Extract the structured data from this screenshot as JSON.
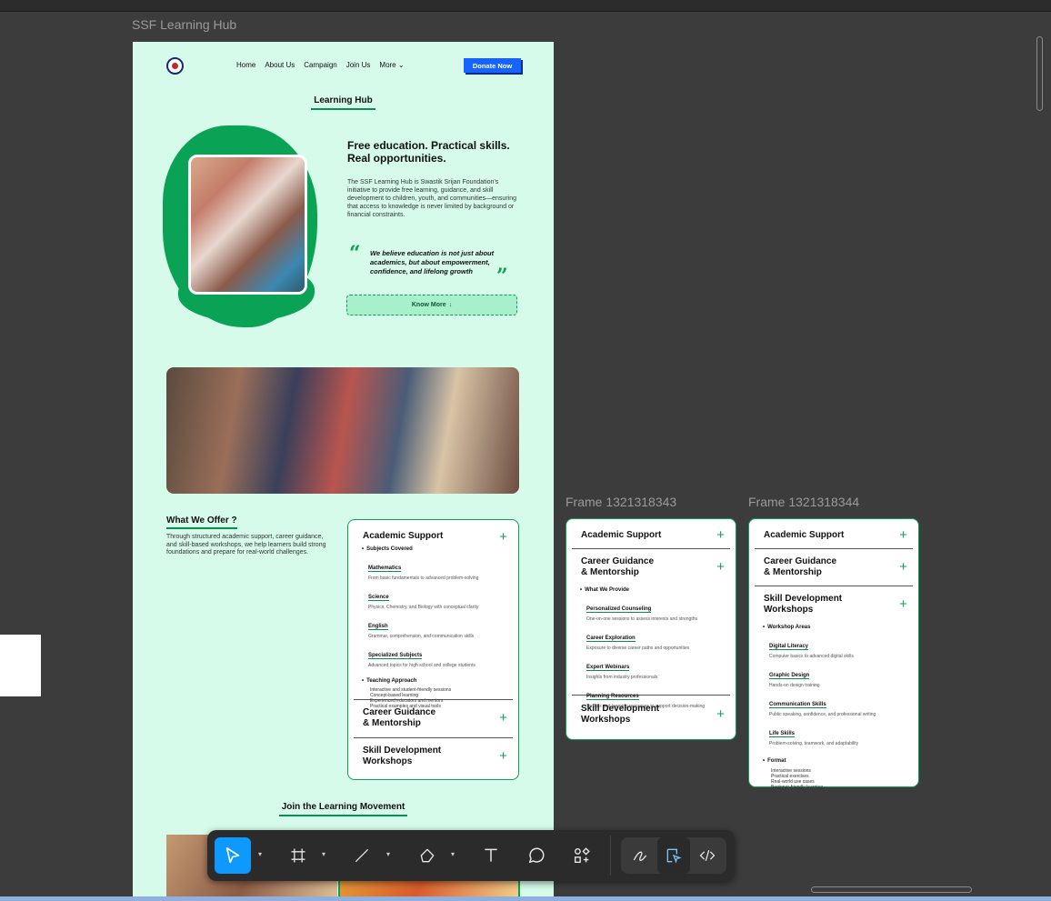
{
  "canvas": {
    "main_frame_title": "SSF Learning Hub",
    "frame_a_title": "Frame 1321318343",
    "frame_b_title": "Frame 1321318344"
  },
  "nav": {
    "links": [
      "Home",
      "About Us",
      "Campaign",
      "Join Us",
      "More"
    ],
    "donate_label": "Donate Now"
  },
  "hero": {
    "section_title": "Learning Hub",
    "heading": "Free education. Practical skills. Real opportunities.",
    "body": "The SSF Learning Hub is Swastik Srijan Foundation's initiative to provide free learning, guidance, and skill development to children, youth, and communities—ensuring that access to knowledge is never limited by background or financial constraints.",
    "quote": "We believe education is not just about academics, but about empowerment, confidence, and lifelong growth",
    "know_more_label": "Know More",
    "quote_open_mark": "“",
    "quote_close_mark": "”"
  },
  "offer": {
    "title": "What We Offer ?",
    "body": "Through structured academic support, career guidance, and skill-based workshops, we help learners build strong foundations and prepare for real-world challenges."
  },
  "accordion": {
    "academic": {
      "title": "Academic Support",
      "subjects_label": "Subjects Covered",
      "subjects": [
        {
          "name": "Mathematics",
          "desc": "From basic fundamentals to advanced problem-solving"
        },
        {
          "name": "Science",
          "desc": "Physics, Chemistry, and Biology with conceptual clarity"
        },
        {
          "name": "English",
          "desc": "Grammar, comprehension, and communication skills"
        },
        {
          "name": "Specialized Subjects",
          "desc": "Advanced topics for high school and college students"
        }
      ],
      "approach_label": "Teaching Approach",
      "approach": [
        "Interactive and student-friendly sessions",
        "Concept-based learning",
        "Experienced educators and mentors",
        "Practical examples and visual tools"
      ]
    },
    "career": {
      "title": "Career Guidance & Mentorship",
      "provide_label": "What We Provide",
      "items": [
        {
          "name": "Personalized Counseling",
          "desc": "One-on-one sessions to assess interests and strengths"
        },
        {
          "name": "Career Exploration",
          "desc": "Exposure to diverse career paths and opportunities"
        },
        {
          "name": "Expert Webinars",
          "desc": "Insights from industry professionals"
        },
        {
          "name": "Planning Resources",
          "desc": "Toolkits and learning resources to support decision-making"
        }
      ]
    },
    "skill": {
      "title": "Skill Development Workshops",
      "areas_label": "Workshop Areas",
      "items": [
        {
          "name": "Digital Literacy",
          "desc": "Computer basics to advanced digital skills"
        },
        {
          "name": "Graphic Design",
          "desc": "Hands-on design training"
        },
        {
          "name": "Communication Skills",
          "desc": "Public speaking, confidence, and professional writing"
        },
        {
          "name": "Life Skills",
          "desc": "Problem-solving, teamwork, and adaptability"
        }
      ],
      "format_label": "Format",
      "format": [
        "Interactive sessions",
        "Practical exercises",
        "Real-world use cases",
        "Beginner-friendly learning"
      ]
    },
    "plus_symbol": "+"
  },
  "join": {
    "title": "Join the Learning Movement"
  },
  "toolbar": {
    "tools": [
      "move-tool",
      "frame-tool",
      "line-tool",
      "pen-tool",
      "text-tool",
      "comment-tool",
      "assets-tool",
      "draw-mode",
      "design-mode",
      "dev-mode"
    ],
    "active_tool": "move-tool",
    "accent": "#0d99ff"
  },
  "colors": {
    "frame_bg": "#d6fbea",
    "accent_green": "#0aa355",
    "donate_blue": "#1763ff"
  }
}
